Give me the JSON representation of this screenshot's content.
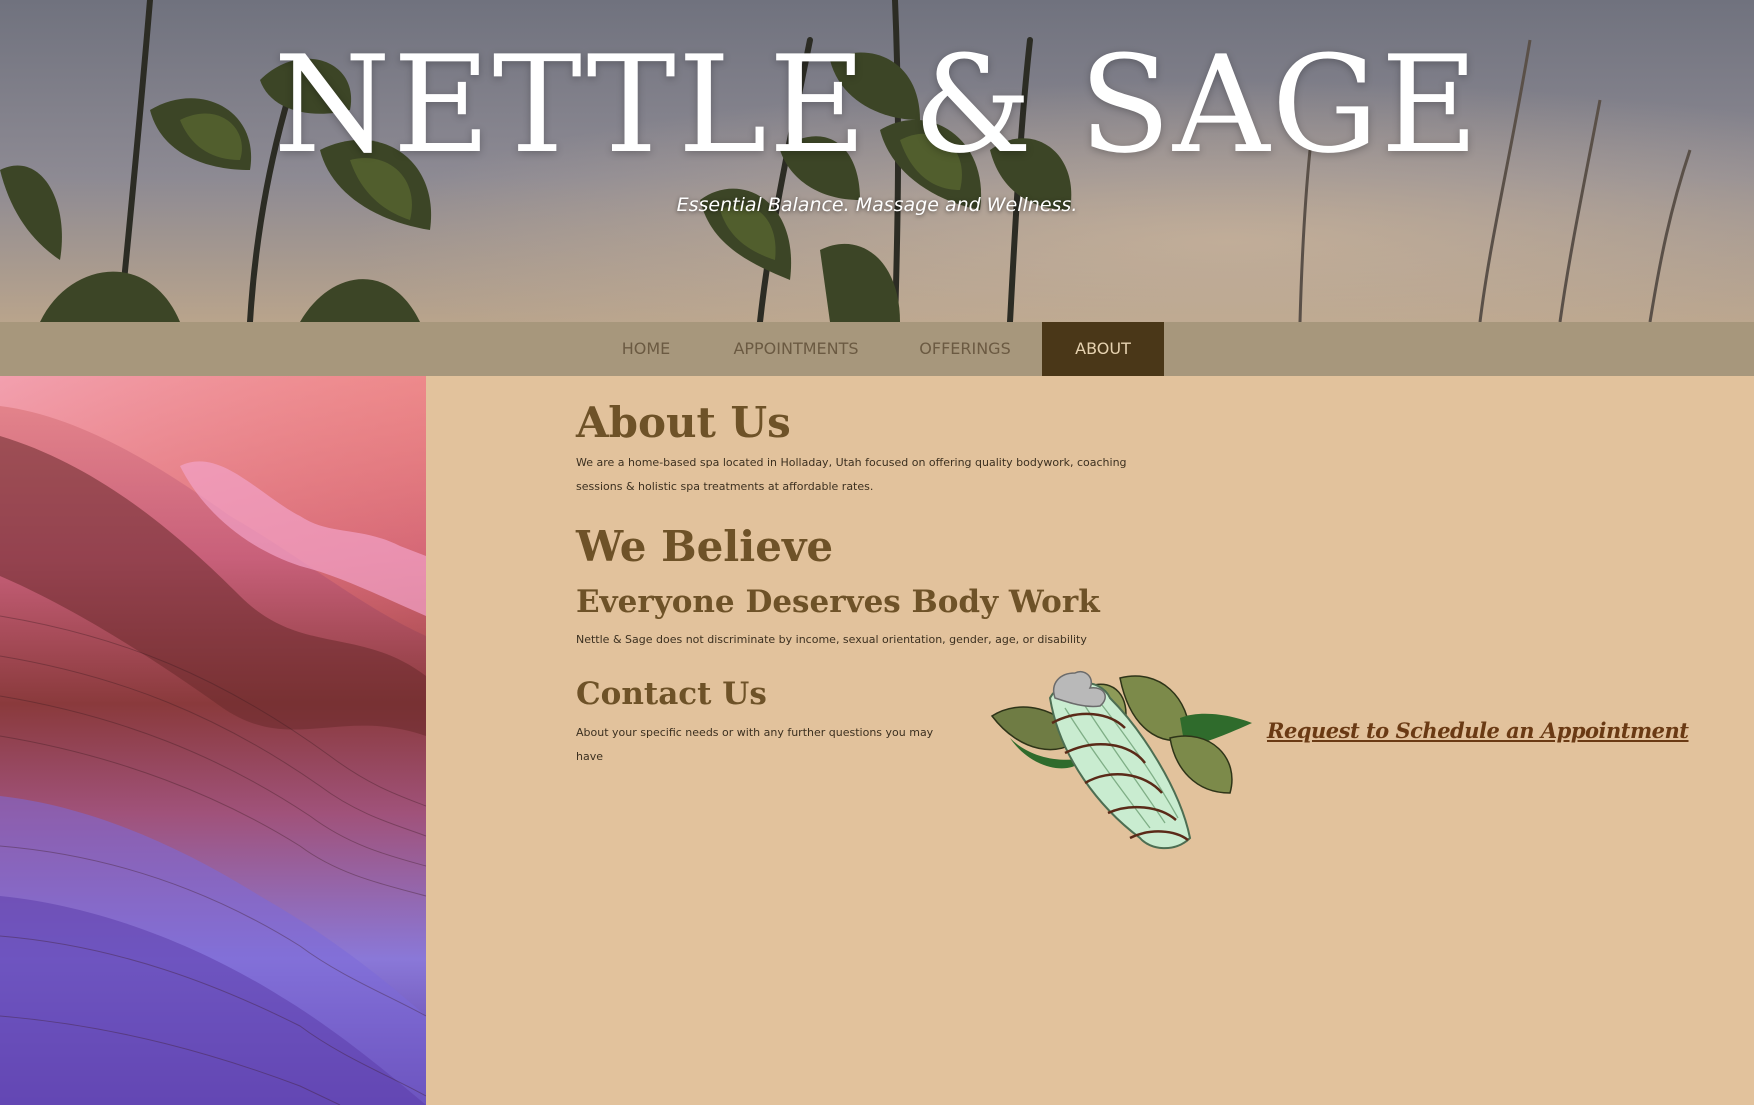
{
  "site": {
    "title": "NETTLE & SAGE",
    "tagline": "Essential Balance. Massage and Wellness."
  },
  "nav": {
    "items": [
      {
        "label": "HOME",
        "active": false
      },
      {
        "label": "APPOINTMENTS",
        "active": false
      },
      {
        "label": "OFFERINGS",
        "active": false
      },
      {
        "label": "ABOUT",
        "active": true
      }
    ]
  },
  "about": {
    "heading": "About Us",
    "text": "We are a home-based spa located in Holladay, Utah focused on offering quality bodywork, coaching sessions & holistic spa treatments at affordable rates."
  },
  "believe": {
    "heading": "We Believe",
    "subheading": "Everyone Deserves Body Work",
    "text": "Nettle & Sage does not discriminate by income, sexual orientation, gender, age, or disability"
  },
  "contact": {
    "heading": "Contact Us",
    "text": "About your specific needs or with any further questions you may have",
    "cta_label": "Request to Schedule an Appointment"
  },
  "colors": {
    "page_bg": "#e2c29c",
    "nav_bg": "#a7977c",
    "nav_active_bg": "#4a3718",
    "heading": "#6e5228",
    "cta": "#6a3a14"
  },
  "icons": {
    "sage_bundle": "sage-bundle-icon"
  }
}
